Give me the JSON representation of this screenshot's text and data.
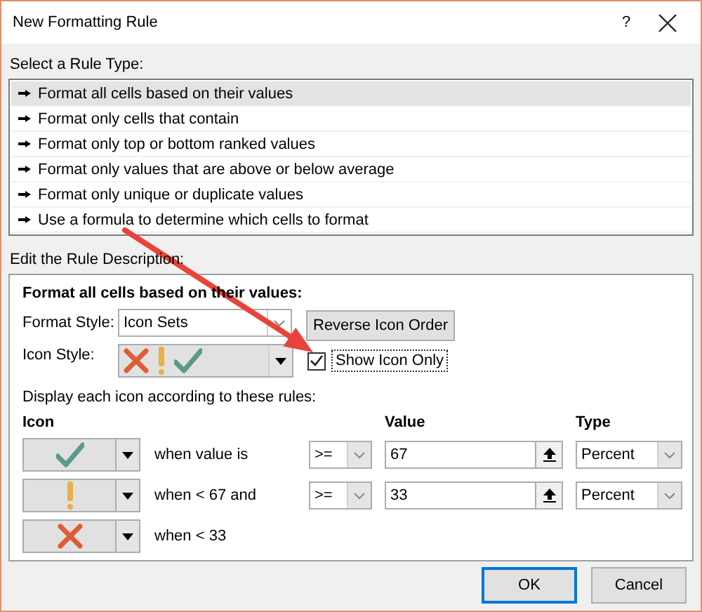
{
  "window": {
    "title": "New Formatting Rule",
    "help": "?"
  },
  "rule_type": {
    "label": "Select a Rule Type:",
    "items": [
      {
        "label": "Format all cells based on their values",
        "selected": true
      },
      {
        "label": "Format only cells that contain",
        "selected": false
      },
      {
        "label": "Format only top or bottom ranked values",
        "selected": false
      },
      {
        "label": "Format only values that are above or below average",
        "selected": false
      },
      {
        "label": "Format only unique or duplicate values",
        "selected": false
      },
      {
        "label": "Use a formula to determine which cells to format",
        "selected": false
      }
    ]
  },
  "description": {
    "label": "Edit the Rule Description:",
    "heading": "Format all cells based on their values:",
    "format_style": {
      "label": "Format Style:",
      "value": "Icon Sets"
    },
    "reverse_button": "Reverse Icon Order",
    "icon_style": {
      "label": "Icon Style:",
      "icons": [
        {
          "kind": "cross"
        },
        {
          "kind": "exclamation"
        },
        {
          "kind": "check"
        }
      ]
    },
    "show_icon_only": {
      "label": "Show Icon Only",
      "checked": true
    },
    "rules_label": "Display each icon according to these rules:",
    "columns": {
      "icon": "Icon",
      "value": "Value",
      "type": "Type"
    },
    "rules": [
      {
        "icon": {
          "kind": "check"
        },
        "condition": "when value is",
        "operator": ">=",
        "value": "67",
        "type": "Percent"
      },
      {
        "icon": {
          "kind": "exclamation"
        },
        "condition": "when < 67 and",
        "operator": ">=",
        "value": "33",
        "type": "Percent"
      },
      {
        "icon": {
          "kind": "cross"
        },
        "condition": "when < 33"
      }
    ]
  },
  "buttons": [
    {
      "label": "OK",
      "default": true
    },
    {
      "label": "Cancel",
      "default": false
    }
  ]
}
